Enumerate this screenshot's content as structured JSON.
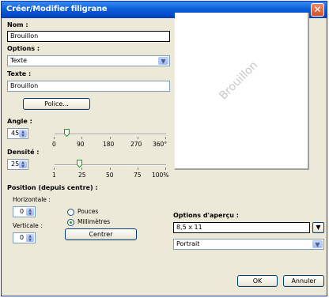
{
  "window": {
    "title": "Créer/Modifier filigrane",
    "close_icon": "close-icon"
  },
  "nom": {
    "label": "Nom :",
    "value": "Brouillon"
  },
  "options": {
    "label": "Options :",
    "selected": "Texte"
  },
  "texte": {
    "label": "Texte :",
    "value": "Brouillon"
  },
  "police_button": "Police...",
  "angle": {
    "label": "Angle :",
    "value": "45",
    "ticks": [
      "0",
      "90",
      "180",
      "270",
      "360°"
    ]
  },
  "densite": {
    "label": "Densité :",
    "value": "25",
    "ticks": [
      "1",
      "25",
      "50",
      "75",
      "100%"
    ]
  },
  "position": {
    "label": "Position (depuis centre) :",
    "horizontal_label": "Horizontale :",
    "horizontal_value": "0",
    "vertical_label": "Verticale :",
    "vertical_value": "0",
    "units": [
      "Pouces",
      "Millimètres"
    ],
    "selected_unit": "Millimètres",
    "center_button": "Centrer"
  },
  "preview": {
    "watermark": "Brouillon"
  },
  "apercu": {
    "label": "Options d'aperçu :",
    "paper": "8,5 x 11",
    "orientation": "Portrait"
  },
  "footer": {
    "ok": "OK",
    "cancel": "Annuler"
  }
}
